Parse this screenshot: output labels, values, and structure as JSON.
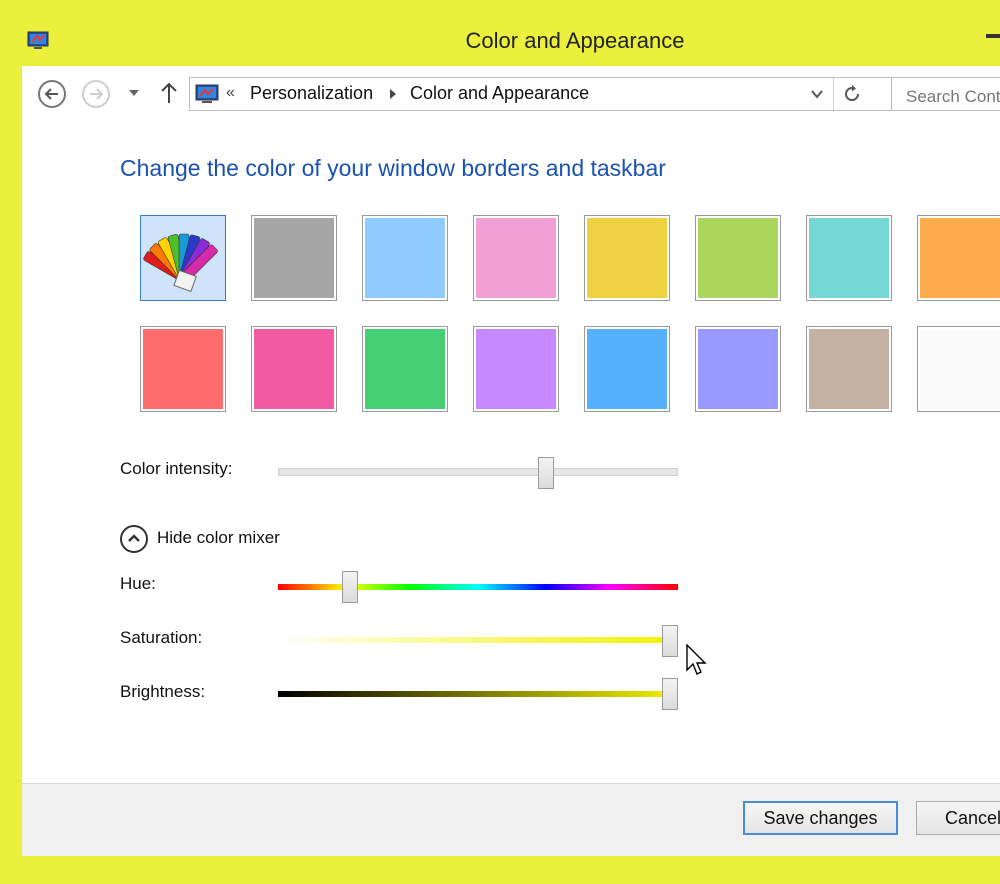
{
  "window": {
    "title": "Color and Appearance",
    "border_color": "#eaf03b"
  },
  "nav": {
    "back_icon": "back-arrow-icon",
    "forward_icon": "forward-arrow-icon",
    "recent_icon": "chevron-down-icon",
    "up_icon": "up-arrow-icon"
  },
  "address": {
    "prefix": "«",
    "crumbs": [
      "Personalization",
      "Color and Appearance"
    ],
    "refresh_icon": "refresh-icon"
  },
  "search": {
    "text": "Search Control Panel"
  },
  "main": {
    "heading": "Change the color of your window borders and taskbar",
    "swatches_row1": [
      {
        "name": "automatic",
        "color": "#a9d3fb",
        "selected": true
      },
      {
        "name": "gray",
        "color": "#a6a6a6"
      },
      {
        "name": "light-blue",
        "color": "#8fcbff"
      },
      {
        "name": "pink",
        "color": "#f29fd6"
      },
      {
        "name": "yellow",
        "color": "#efd142"
      },
      {
        "name": "green",
        "color": "#aad65e"
      },
      {
        "name": "teal",
        "color": "#76d8d4"
      },
      {
        "name": "orange",
        "color": "#ffaa4b"
      }
    ],
    "swatches_row2": [
      {
        "name": "red",
        "color": "#ff6c6c"
      },
      {
        "name": "magenta",
        "color": "#f35aa4"
      },
      {
        "name": "emerald",
        "color": "#47cf76"
      },
      {
        "name": "purple",
        "color": "#c689ff"
      },
      {
        "name": "blue",
        "color": "#55b0ff"
      },
      {
        "name": "lavender",
        "color": "#9999ff"
      },
      {
        "name": "taupe",
        "color": "#c3b2a4"
      },
      {
        "name": "white",
        "color": "#fafafa"
      }
    ],
    "intensity": {
      "label": "Color intensity:",
      "value": 0.67
    },
    "mixer_toggle": "Hide color mixer",
    "hue": {
      "label": "Hue:",
      "value": 0.18
    },
    "saturation": {
      "label": "Saturation:",
      "value": 0.98
    },
    "brightness": {
      "label": "Brightness:",
      "value": 0.98
    }
  },
  "footer": {
    "save_label": "Save changes",
    "cancel_label": "Cancel"
  }
}
